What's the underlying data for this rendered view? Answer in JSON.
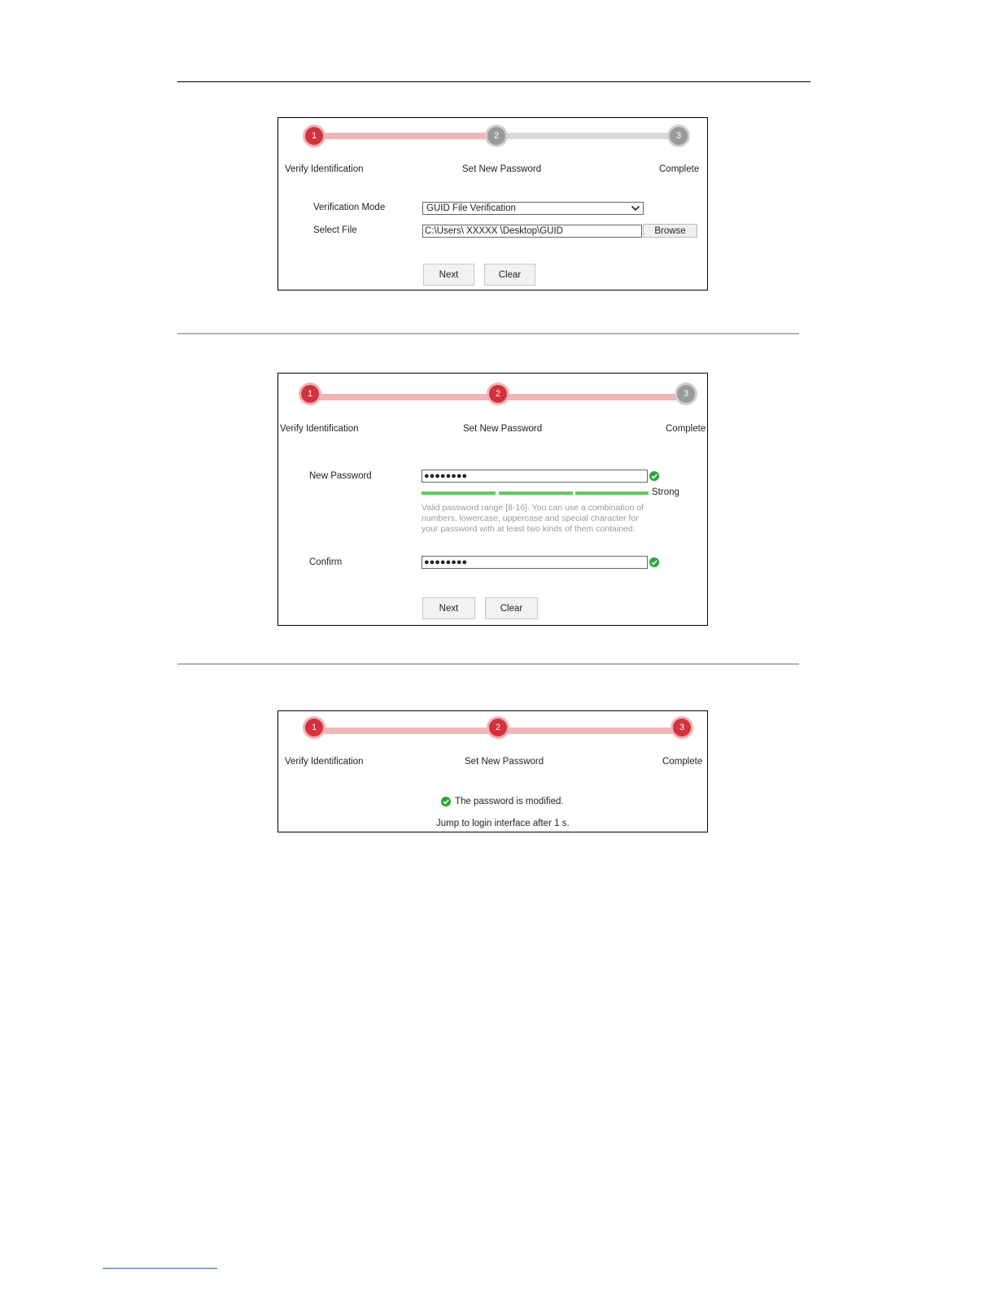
{
  "steps": {
    "one": "1",
    "two": "2",
    "three": "3",
    "verify_label": "Verify Identification",
    "set_label": "Set New Password",
    "complete_label": "Complete"
  },
  "panel1": {
    "mode_label": "Verification Mode",
    "mode_value": "GUID File Verification",
    "file_label": "Select File",
    "file_value": "C:\\Users\\  XXXXX  \\Desktop\\GUID",
    "browse": "Browse",
    "next": "Next",
    "clear": "Clear"
  },
  "panel2": {
    "new_password_label": "New Password",
    "new_password_value": "●●●●●●●●",
    "strength_label": "Strong",
    "strength_level": 3,
    "strength_max": 3,
    "hint": "Valid password range [8-16]. You can use a combination of numbers, lowercase, uppercase and special character for your password with at least two kinds of them contained.",
    "confirm_label": "Confirm",
    "confirm_value": "●●●●●●●●",
    "next": "Next",
    "clear": "Clear"
  },
  "panel3": {
    "modified_msg": "The password is modified.",
    "jump_msg": "Jump to login interface after 1 s."
  },
  "colors": {
    "active_step": "#d5313c",
    "inactive_step": "#9a9a9a",
    "progress_done": "#f2b5b8",
    "progress_todo": "#d9d9d9",
    "success": "#22aa33",
    "strength_bar": "#5ccc5c"
  }
}
